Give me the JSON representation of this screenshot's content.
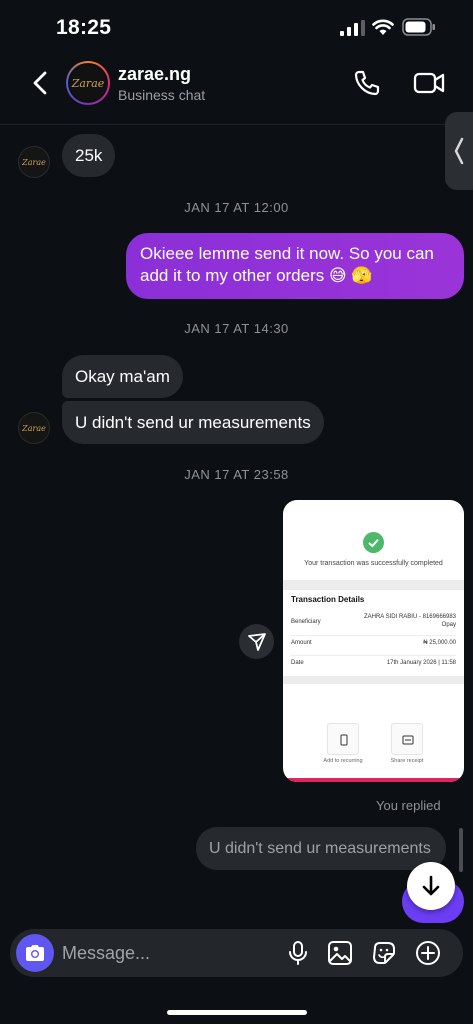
{
  "status_bar": {
    "time": "18:25"
  },
  "header": {
    "back_icon": "chevron-left-icon",
    "avatar_text": "Zarae",
    "title": "zarae.ng",
    "subtitle": "Business chat",
    "call_icon": "phone-icon",
    "video_icon": "video-camera-icon"
  },
  "messages": {
    "in_1": "25k",
    "ts_1": "JAN 17 AT 12:00",
    "out_1": "Okieee lemme send it now. So you can add it to my other orders 😅 🫣",
    "ts_2": "JAN 17 AT 14:30",
    "in_2": "Okay ma'am",
    "in_3": "U didn't send ur measurements",
    "ts_3": "JAN 17 AT 23:58"
  },
  "receipt": {
    "success_text": "Your transaction was successfully completed",
    "details_title": "Transaction Details",
    "rows": [
      {
        "key": "Beneficiary",
        "value": "ZAHRA SIDI RABIU - 8169666983",
        "value2": "Opay"
      },
      {
        "key": "Amount",
        "value": "₦ 25,000.00"
      },
      {
        "key": "Date",
        "value": "17th January 2026 | 11:58"
      }
    ],
    "actions": [
      "Add to recurring",
      "Share receipt"
    ]
  },
  "reply": {
    "label": "You replied",
    "quoted": "U didn't send ur measurements"
  },
  "composer": {
    "placeholder": "Message...",
    "icons": [
      "camera-icon",
      "microphone-icon",
      "gallery-icon",
      "sticker-icon",
      "plus-icon"
    ]
  },
  "colors": {
    "background": "#0c0f14",
    "incoming_bubble": "#26292e",
    "outgoing_bubble": "#8e2de2",
    "accent": "#5f57f0"
  }
}
